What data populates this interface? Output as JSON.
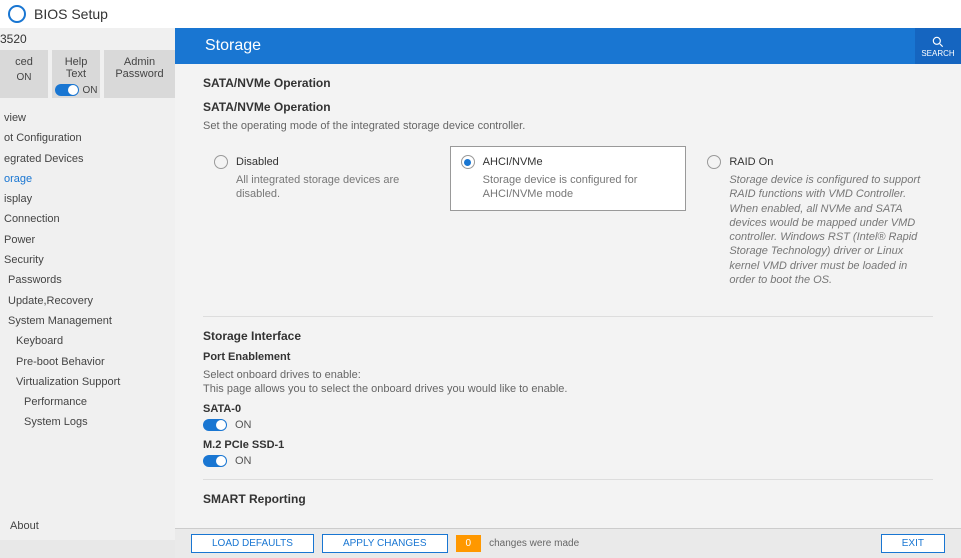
{
  "title": "BIOS Setup",
  "model": "3520",
  "tiles": [
    {
      "label": "ced",
      "state": "ON",
      "toggle": false
    },
    {
      "label": "Help Text",
      "state": "ON",
      "toggle": true
    },
    {
      "label": "Admin Password",
      "state": "",
      "toggle": false
    }
  ],
  "nav": [
    {
      "label": "view",
      "level": 0
    },
    {
      "label": "ot Configuration",
      "level": 0
    },
    {
      "label": "egrated Devices",
      "level": 0
    },
    {
      "label": "orage",
      "level": 0,
      "active": true
    },
    {
      "label": "isplay",
      "level": 0
    },
    {
      "label": "Connection",
      "level": 0
    },
    {
      "label": "Power",
      "level": 0
    },
    {
      "label": "Security",
      "level": 0
    },
    {
      "label": "Passwords",
      "level": 1
    },
    {
      "label": "Update,Recovery",
      "level": 1
    },
    {
      "label": "System Management",
      "level": 1
    },
    {
      "label": "Keyboard",
      "level": 2
    },
    {
      "label": "Pre-boot Behavior",
      "level": 2
    },
    {
      "label": "Virtualization Support",
      "level": 2
    },
    {
      "label": "Performance",
      "level": 3
    },
    {
      "label": "System Logs",
      "level": 3
    }
  ],
  "about": "About",
  "header": "Storage",
  "search_label": "SEARCH",
  "section1": {
    "title": "SATA/NVMe Operation",
    "subtitle": "SATA/NVMe Operation",
    "desc": "Set the operating mode of the integrated storage device controller.",
    "options": [
      {
        "label": "Disabled",
        "desc": "All integrated storage devices are disabled.",
        "selected": false
      },
      {
        "label": "AHCI/NVMe",
        "desc": "Storage device is configured for AHCI/NVMe mode",
        "selected": true
      },
      {
        "label": "RAID On",
        "desc": "Storage device is configured to support RAID functions with VMD Controller. When enabled, all NVMe and SATA devices would be mapped under VMD controller. Windows RST (Intel® Rapid Storage Technology) driver or Linux kernel VMD driver must be loaded in order to boot the OS.",
        "selected": false
      }
    ]
  },
  "section2": {
    "title": "Storage Interface",
    "subtitle": "Port Enablement",
    "line1": "Select onboard drives to enable:",
    "line2": "This page allows you to select the onboard drives you would like to enable.",
    "ports": [
      {
        "label": "SATA-0",
        "state": "ON"
      },
      {
        "label": "M.2 PCIe SSD-1",
        "state": "ON"
      }
    ]
  },
  "section3": {
    "title": "SMART Reporting"
  },
  "footer": {
    "load_defaults": "LOAD DEFAULTS",
    "apply": "APPLY CHANGES",
    "badge": "0",
    "note": "changes were made",
    "exit": "EXIT"
  }
}
